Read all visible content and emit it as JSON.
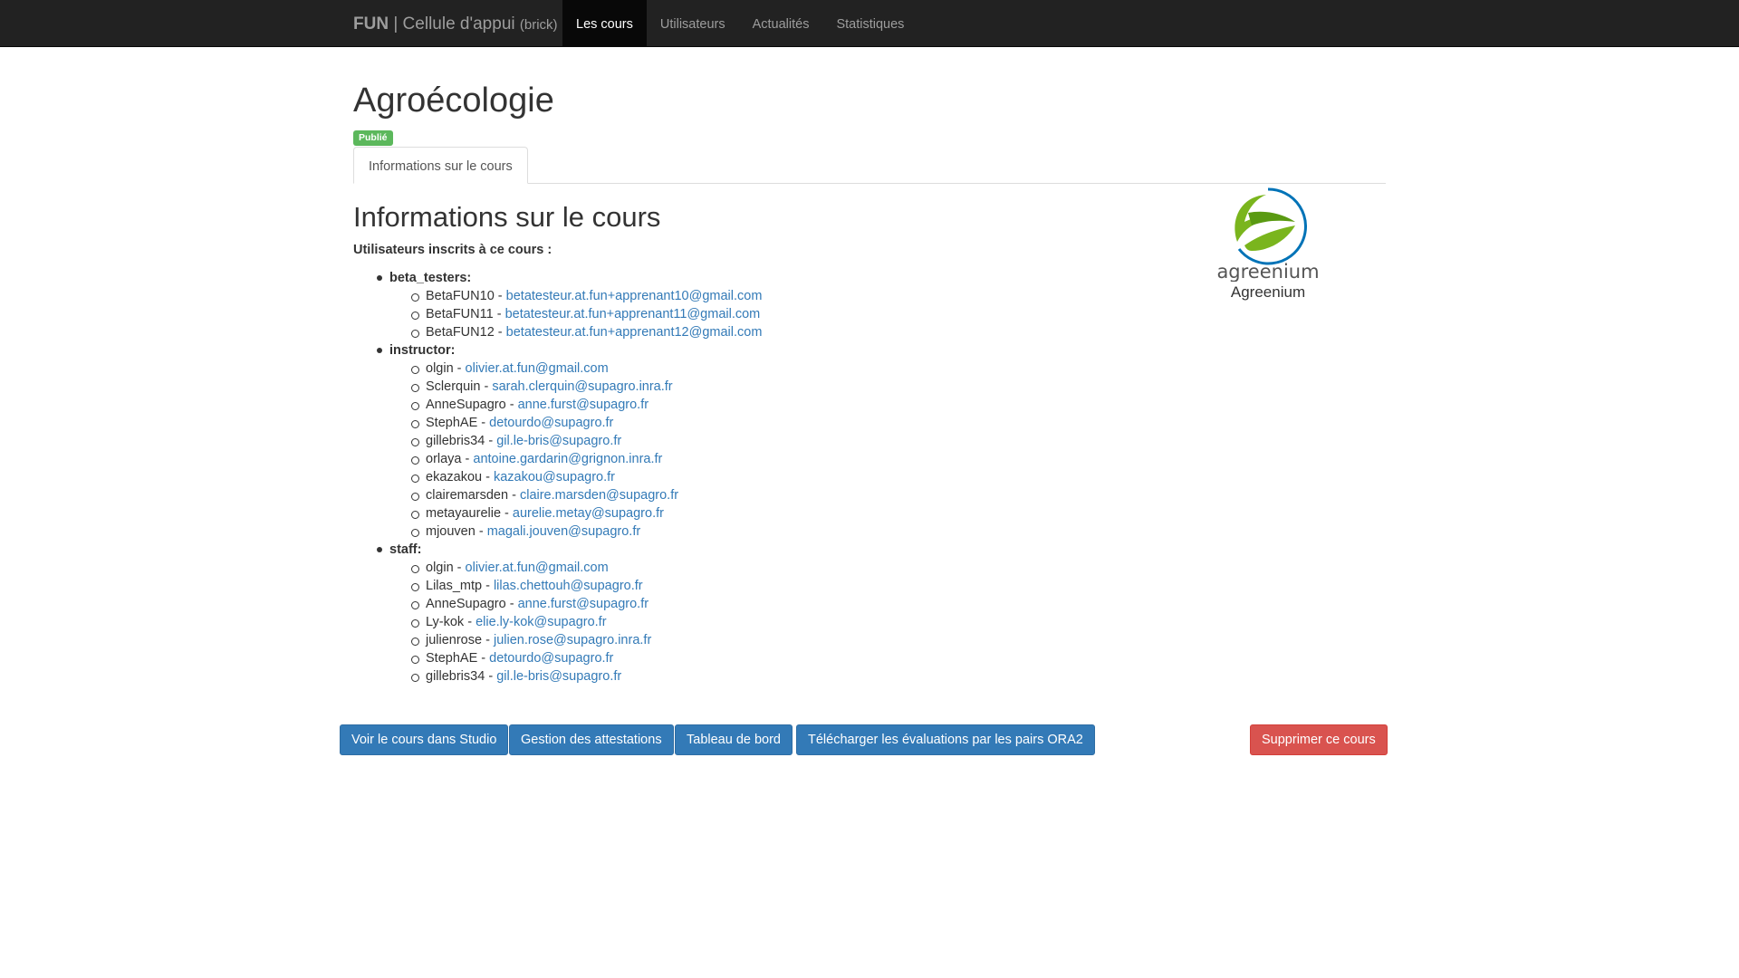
{
  "navbar": {
    "brand_strong": "FUN",
    "brand_text": " | Cellule d'appui ",
    "brand_small": "(brick)",
    "links": [
      "Les cours",
      "Utilisateurs",
      "Actualités",
      "Statistiques"
    ]
  },
  "course": {
    "title": "Agroécologie",
    "status_badge": "Publié",
    "tab_label": "Informations sur le cours",
    "section_title": "Informations sur le cours",
    "enrolled_heading": "Utilisateurs inscrits à ce cours :"
  },
  "groups": [
    {
      "label": "beta_testers:",
      "members": [
        {
          "username": "BetaFUN10",
          "email": "betatesteur.at.fun+apprenant10@gmail.com"
        },
        {
          "username": "BetaFUN11",
          "email": "betatesteur.at.fun+apprenant11@gmail.com"
        },
        {
          "username": "BetaFUN12",
          "email": "betatesteur.at.fun+apprenant12@gmail.com"
        }
      ]
    },
    {
      "label": "instructor:",
      "members": [
        {
          "username": "olgin",
          "email": "olivier.at.fun@gmail.com"
        },
        {
          "username": "Sclerquin",
          "email": "sarah.clerquin@supagro.inra.fr"
        },
        {
          "username": "AnneSupagro",
          "email": "anne.furst@supagro.fr"
        },
        {
          "username": "StephAE",
          "email": "detourdo@supagro.fr"
        },
        {
          "username": "gillebris34",
          "email": "gil.le-bris@supagro.fr"
        },
        {
          "username": "orlaya",
          "email": "antoine.gardarin@grignon.inra.fr"
        },
        {
          "username": "ekazakou",
          "email": "kazakou@supagro.fr"
        },
        {
          "username": "clairemarsden",
          "email": "claire.marsden@supagro.fr"
        },
        {
          "username": "metayaurelie",
          "email": "aurelie.metay@supagro.fr"
        },
        {
          "username": "mjouven",
          "email": "magali.jouven@supagro.fr"
        }
      ]
    },
    {
      "label": "staff:",
      "members": [
        {
          "username": "olgin",
          "email": "olivier.at.fun@gmail.com"
        },
        {
          "username": "Lilas_mtp",
          "email": "lilas.chettouh@supagro.fr"
        },
        {
          "username": "AnneSupagro",
          "email": "anne.furst@supagro.fr"
        },
        {
          "username": "Ly-kok",
          "email": "elie.ly-kok@supagro.fr"
        },
        {
          "username": "julienrose",
          "email": "julien.rose@supagro.inra.fr"
        },
        {
          "username": "StephAE",
          "email": "detourdo@supagro.fr"
        },
        {
          "username": "gillebris34",
          "email": "gil.le-bris@supagro.fr"
        }
      ]
    }
  ],
  "university": {
    "logo_text": "agreenium",
    "name": "Agreenium"
  },
  "actions": {
    "studio": "Voir le cours dans Studio",
    "certificates": "Gestion des attestations",
    "dashboard": "Tableau de bord",
    "ora2": "Télécharger les évaluations par les pairs ORA2",
    "delete": "Supprimer ce cours"
  },
  "colors": {
    "navbar_bg": "#222222",
    "link": "#337ab7",
    "primary_button": "#337ab7",
    "danger_button": "#d9534f",
    "badge_success": "#5cb85c",
    "logo_green": "#7ab51d",
    "logo_blue": "#0073b7"
  }
}
